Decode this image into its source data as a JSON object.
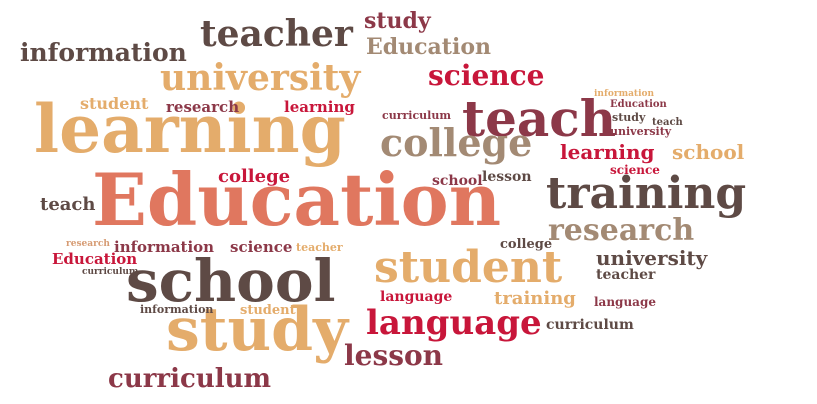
{
  "palette": {
    "salmon": "#e0775f",
    "tan": "#e4ac6b",
    "dark_brown": "#5e4a45",
    "crimson": "#c8163a",
    "maroon": "#8c3848",
    "taupe": "#a38a74"
  },
  "cloud": {
    "primary": {
      "education": "Education",
      "learning": "learning",
      "school": "school",
      "study": "study",
      "training": "training",
      "teach": "teach",
      "student": "student",
      "university": "university",
      "college": "college",
      "language": "language",
      "research": "research",
      "curriculum": "curriculum",
      "lesson": "lesson",
      "teacher": "teacher",
      "information": "information",
      "science": "science",
      "top_study": "study",
      "top_education": "Education"
    },
    "secondary": {
      "student": "student",
      "research": "research",
      "learning": "learning",
      "learning_right": "learning",
      "school_right": "school",
      "college_mid": "college",
      "teach_left": "teach",
      "education_left": "Education",
      "curriculum_left": "curriculum",
      "information_left": "information",
      "science_mid": "science",
      "teacher_mid": "teacher",
      "college_right": "college",
      "research_left": "research",
      "university_right": "university",
      "teacher_right": "teacher",
      "training_right": "training",
      "language_right": "language",
      "curriculum_right": "curriculum",
      "student_mid": "student",
      "information_bottom": "information",
      "language_mid": "language",
      "curriculum_mid": "curriculum",
      "lesson_mid": "lesson",
      "school_mid": "school",
      "science_right": "science",
      "study_right": "study",
      "teach_right": "teach",
      "university_small": "university",
      "education_small": "Education",
      "information_small": "information"
    }
  }
}
